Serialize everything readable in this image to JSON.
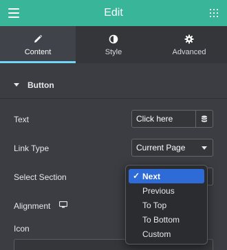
{
  "header": {
    "title": "Edit",
    "menu_icon": "hamburger-icon",
    "apps_icon": "grid-icon"
  },
  "tabs": [
    {
      "label": "Content",
      "icon": "pencil-icon",
      "active": true
    },
    {
      "label": "Style",
      "icon": "contrast-icon",
      "active": false
    },
    {
      "label": "Advanced",
      "icon": "gear-icon",
      "active": false
    }
  ],
  "section": {
    "title": "Button"
  },
  "fields": {
    "text": {
      "label": "Text",
      "value": "Click here"
    },
    "link_type": {
      "label": "Link Type",
      "value": "Current Page"
    },
    "select_section": {
      "label": "Select Section"
    },
    "alignment": {
      "label": "Alignment"
    },
    "icon": {
      "label": "Icon"
    }
  },
  "dropdown": {
    "selected": "Next",
    "options": [
      "Next",
      "Previous",
      "To Top",
      "To Bottom",
      "Custom"
    ]
  },
  "colors": {
    "header_bg": "#39b69a",
    "panel_bg": "#3b3d42",
    "tab_active_underline": "#71d7f7",
    "dropdown_selected": "#2f6bd6"
  }
}
